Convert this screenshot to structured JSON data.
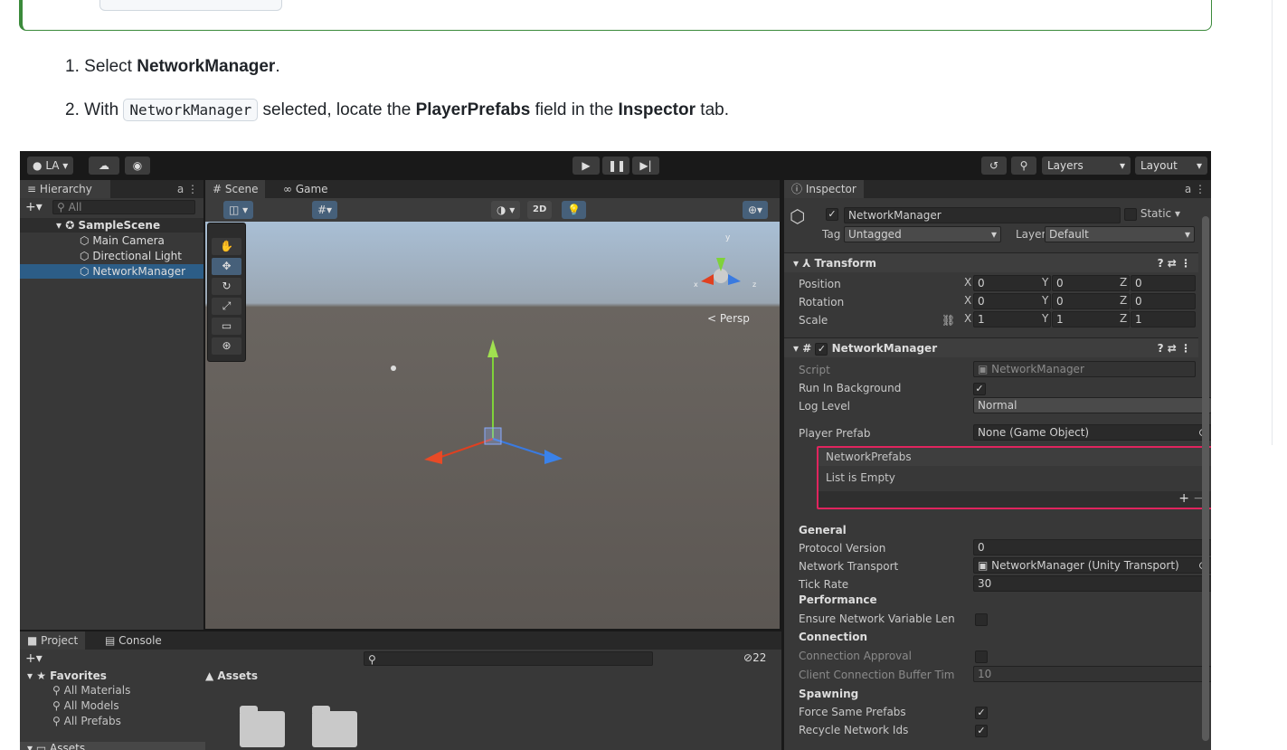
{
  "doc": {
    "step1": {
      "num": "1.",
      "pre": "Select ",
      "bold": "NetworkManager",
      "post": "."
    },
    "step2": {
      "num": "2.",
      "pre": "With ",
      "code": "NetworkManager",
      "mid": " selected, locate the ",
      "bold1": "PlayerPrefabs",
      "mid2": " field in the ",
      "bold2": "Inspector",
      "post": " tab."
    }
  },
  "unity": {
    "account": "LA",
    "toolbar_right": {
      "layers": "Layers",
      "layout": "Layout"
    },
    "hierarchy": {
      "tab": "Hierarchy",
      "search_placeholder": "All",
      "scene": "SampleScene",
      "items": [
        "Main Camera",
        "Directional Light",
        "NetworkManager"
      ]
    },
    "scene_tabs": {
      "scene": "Scene",
      "game": "Game"
    },
    "scene_toolbar": {
      "mode_2d": "2D"
    },
    "gizmo": {
      "persp": "Persp",
      "x": "x",
      "y": "y",
      "z": "z"
    },
    "inspector": {
      "tab": "Inspector",
      "object_name": "NetworkManager",
      "static_label": "Static",
      "tag_label": "Tag",
      "tag_value": "Untagged",
      "layer_label": "Layer",
      "layer_value": "Default",
      "transform": {
        "title": "Transform",
        "rows": [
          {
            "label": "Position",
            "x": "0",
            "y": "0",
            "z": "0"
          },
          {
            "label": "Rotation",
            "x": "0",
            "y": "0",
            "z": "0"
          },
          {
            "label": "Scale",
            "x": "1",
            "y": "1",
            "z": "1"
          }
        ],
        "axis": {
          "x": "X",
          "y": "Y",
          "z": "Z"
        }
      },
      "component": {
        "title": "NetworkManager",
        "script_label": "Script",
        "script_value": "NetworkManager",
        "run_bg_label": "Run In Background",
        "log_level_label": "Log Level",
        "log_level_value": "Normal",
        "player_prefab_label": "Player Prefab",
        "player_prefab_value": "None (Game Object)",
        "prefabs_list_label": "NetworkPrefabs",
        "list_empty": "List is Empty",
        "add": "+",
        "remove": "−",
        "general": "General",
        "protocol_label": "Protocol Version",
        "protocol_value": "0",
        "transport_label": "Network Transport",
        "transport_value": "NetworkManager (Unity Transport)",
        "tick_label": "Tick Rate",
        "tick_value": "30",
        "performance": "Performance",
        "ensure_label": "Ensure Network Variable Len",
        "connection": "Connection",
        "conn_approval_label": "Connection Approval",
        "client_buffer_label": "Client Connection Buffer Tim",
        "client_buffer_value": "10",
        "spawning": "Spawning",
        "force_same_label": "Force Same Prefabs",
        "recycle_label": "Recycle Network Ids"
      }
    },
    "project": {
      "tab_project": "Project",
      "tab_console": "Console",
      "favorites": "Favorites",
      "fav_items": [
        "All Materials",
        "All Models",
        "All Prefabs"
      ],
      "assets_header": "Assets",
      "assets_tree": "Assets",
      "hidden_count": "22"
    },
    "highlight_color": "#e0245e"
  }
}
